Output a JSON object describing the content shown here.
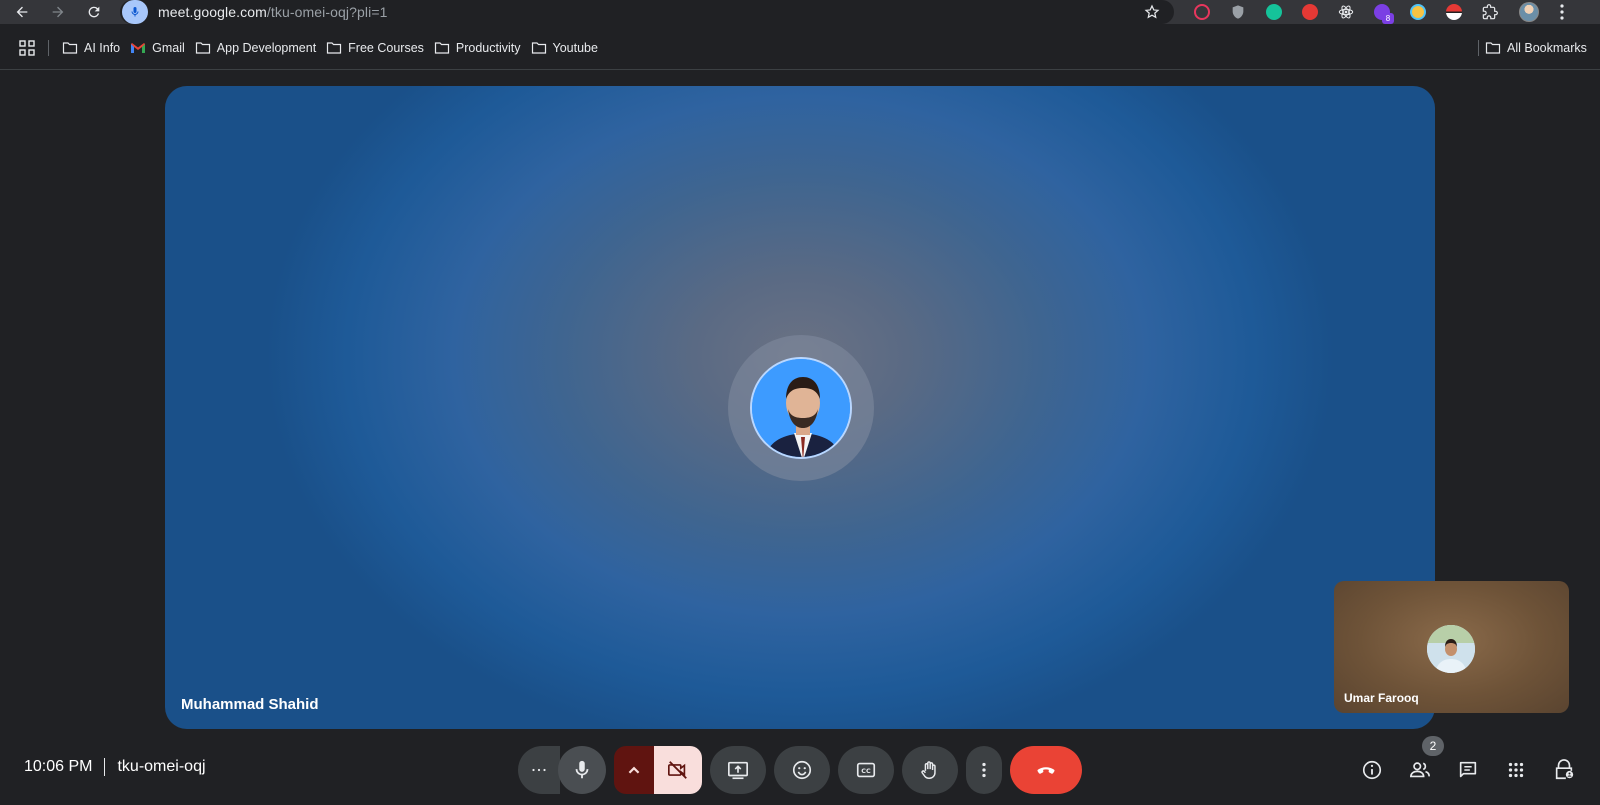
{
  "browser": {
    "url_host": "meet.google.com",
    "url_path": "/tku-omei-oqj?pli=1",
    "extensions": [
      {
        "name": "record-icon",
        "color": "#e8365d"
      },
      {
        "name": "shield-icon",
        "color": "#9aa0a6"
      },
      {
        "name": "grammarly-icon",
        "color": "#15c39a"
      },
      {
        "name": "stop-hand-icon",
        "color": "#e53935"
      },
      {
        "name": "react-icon",
        "color": "#e8eaed"
      },
      {
        "name": "purple-ext-icon",
        "color": "#7b3fe4",
        "badge": "8"
      },
      {
        "name": "clock-ext-icon",
        "color": "#f6c343"
      },
      {
        "name": "pokeball-icon",
        "color": "#e53935"
      },
      {
        "name": "puzzle-icon",
        "color": "#e8eaed"
      }
    ]
  },
  "bookmarks": {
    "items": [
      {
        "label": "AI Info",
        "icon": "folder-icon"
      },
      {
        "label": "Gmail",
        "icon": "gmail-icon"
      },
      {
        "label": "App Development",
        "icon": "folder-icon"
      },
      {
        "label": "Free Courses",
        "icon": "folder-icon"
      },
      {
        "label": "Productivity",
        "icon": "folder-icon"
      },
      {
        "label": "Youtube",
        "icon": "folder-icon"
      }
    ],
    "all_bookmarks": "All Bookmarks"
  },
  "meet": {
    "main_participant": "Muhammad Shahid",
    "self_participant": "Umar Farooq",
    "time": "10:06 PM",
    "meeting_code": "tku-omei-oqj",
    "participant_count": "2",
    "colors": {
      "hangup": "#ea4335",
      "camera_off_bg": "#f9dedc",
      "camera_off_dark": "#601410",
      "control_bg": "#3c4043"
    }
  }
}
